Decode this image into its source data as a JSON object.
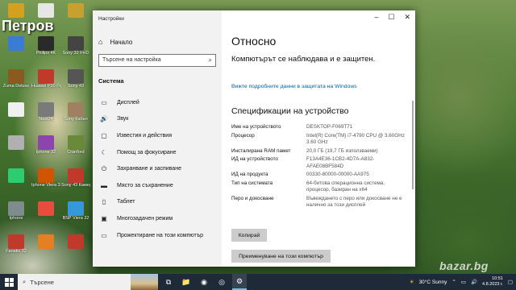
{
  "desktop": {
    "title": "Петров",
    "icons": [
      {
        "label": "",
        "color": "#d4a020"
      },
      {
        "label": "",
        "color": "#e6e6e6"
      },
      {
        "label": "",
        "color": "#c8a030"
      },
      {
        "label": "",
        "color": "#3a7bd5"
      },
      {
        "label": "Philips 4K",
        "color": "#2a2a2a"
      },
      {
        "label": "Sony 32 FHD",
        "color": "#444444"
      },
      {
        "label": "Zuma Deluxe",
        "color": "#8a5a20"
      },
      {
        "label": "Huawei P30 Pro",
        "color": "#c0392b"
      },
      {
        "label": "Sony 43",
        "color": "#555555"
      },
      {
        "label": "",
        "color": "#f0f0f0"
      },
      {
        "label": "Nest24",
        "color": "#7a7a7a"
      },
      {
        "label": "Sony Кабел",
        "color": "#a08060"
      },
      {
        "label": "",
        "color": "#b0b0b0"
      },
      {
        "label": "Iphone 32",
        "color": "#8e44ad"
      },
      {
        "label": "Cranford",
        "color": "#6a8a3a"
      },
      {
        "label": "",
        "color": "#2ecc71"
      },
      {
        "label": "Iphone Viera 32",
        "color": "#d35400"
      },
      {
        "label": "Sony 43 Камера",
        "color": "#c0392b"
      },
      {
        "label": "Iphone",
        "color": "#7f8c8d"
      },
      {
        "label": "",
        "color": "#e74c3c"
      },
      {
        "label": "BSP Viera 32",
        "color": "#3498db"
      },
      {
        "label": "Fanatic 32",
        "color": "#c0392b"
      },
      {
        "label": "",
        "color": "#e67e22"
      },
      {
        "label": "",
        "color": "#c0392b"
      }
    ]
  },
  "window": {
    "title": "Настройки",
    "controls": [
      "–",
      "☐",
      "✕"
    ],
    "sidebar": {
      "home_label": "Начало",
      "search_placeholder": "Търсене на настройка",
      "section_title": "Система",
      "items": [
        {
          "label": "Дисплей",
          "icon": "monitor-icon",
          "glyph": "▭"
        },
        {
          "label": "Звук",
          "icon": "speaker-icon",
          "glyph": "🔊"
        },
        {
          "label": "Известия и действия",
          "icon": "notification-icon",
          "glyph": "▢"
        },
        {
          "label": "Помощ за фокусиране",
          "icon": "moon-icon",
          "glyph": "☾"
        },
        {
          "label": "Захранване и заспиване",
          "icon": "power-icon",
          "glyph": "⏻"
        },
        {
          "label": "Място за съхранение",
          "icon": "storage-icon",
          "glyph": "▬"
        },
        {
          "label": "Таблет",
          "icon": "tablet-icon",
          "glyph": "▯"
        },
        {
          "label": "Многозадачен режим",
          "icon": "multitask-icon",
          "glyph": "▣"
        },
        {
          "label": "Прожектиране на този компютър",
          "icon": "projector-icon",
          "glyph": "▭"
        }
      ]
    },
    "content": {
      "title": "Относно",
      "status": "Компютърът се наблюдава и е защитен.",
      "security_link": "Вижте подробните данни в защитата на Windows",
      "specs_title": "Спецификации на устройство",
      "specs": [
        {
          "key": "Име на устройството",
          "value": "DESKTOP-F069T71"
        },
        {
          "key": "Процесор",
          "value": "Intel(R) Core(TM) i7-4790 CPU @ 3.60GHz   3.60 GHz"
        },
        {
          "key": "Инсталирана RAM памет",
          "value": "20,0 ГБ (19,7 ГБ използваеми)"
        },
        {
          "key": "ИД на устройството",
          "value": "F13A4E36-1CB2-4D7A-A832-AFAE08BF584D"
        },
        {
          "key": "ИД на продукта",
          "value": "00330-80000-00000-AA975"
        },
        {
          "key": "Тип на системата",
          "value": "64-битова операционна система, процесор, базиран на x64"
        },
        {
          "key": "Перо и докосване",
          "value": "Въвеждането с перо или докосване не е налично за този дисплей"
        }
      ],
      "copy_button": "Копирай",
      "rename_button": "Преименуване на този компютър"
    }
  },
  "taskbar": {
    "search_placeholder": "Търсене",
    "apps": [
      {
        "name": "task-view-icon",
        "glyph": "⧉",
        "active": false
      },
      {
        "name": "file-explorer-icon",
        "glyph": "📁",
        "active": false
      },
      {
        "name": "firefox-icon",
        "glyph": "◉",
        "active": false
      },
      {
        "name": "chrome-icon",
        "glyph": "◎",
        "active": false
      },
      {
        "name": "settings-icon",
        "glyph": "⚙",
        "active": true
      }
    ],
    "weather": "30°C  Sunny",
    "time": "10:51",
    "date": "4.8.2023 г."
  },
  "watermark": "bazar.bg"
}
